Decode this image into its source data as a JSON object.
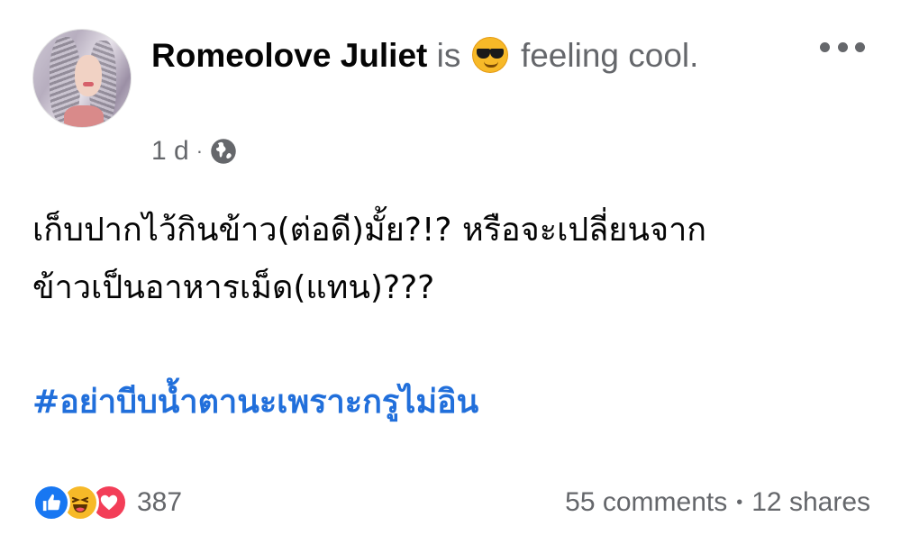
{
  "post": {
    "author": "Romeolove Juliet",
    "verb": "is",
    "feeling_emoji": "smiling-face-with-sunglasses-icon",
    "feeling_text": "feeling cool.",
    "time": "1 d",
    "meta_separator": "·",
    "privacy_icon": "globe-icon",
    "menu_icon": "more-horizontal-icon",
    "body_line1": "เก็บปากไว้กินข้าว(ต่อดี)มั้ย?!? หรือจะเปลี่ยนจาก",
    "body_line2": "ข้าวเป็นอาหารเม็ด(แทน)???",
    "hashtag": "#อย่าบีบน้ำตานะเพราะกรูไม่อิน"
  },
  "footer": {
    "reaction_icons": [
      "like-icon",
      "haha-icon",
      "love-icon"
    ],
    "reaction_count": "387",
    "comments": "55 comments",
    "separator": "•",
    "shares": "12 shares"
  },
  "colors": {
    "hashtag": "#216fdb",
    "like": "#1877f2",
    "haha": "#f7b928",
    "love": "#f33e58",
    "secondary_text": "#65676b"
  }
}
